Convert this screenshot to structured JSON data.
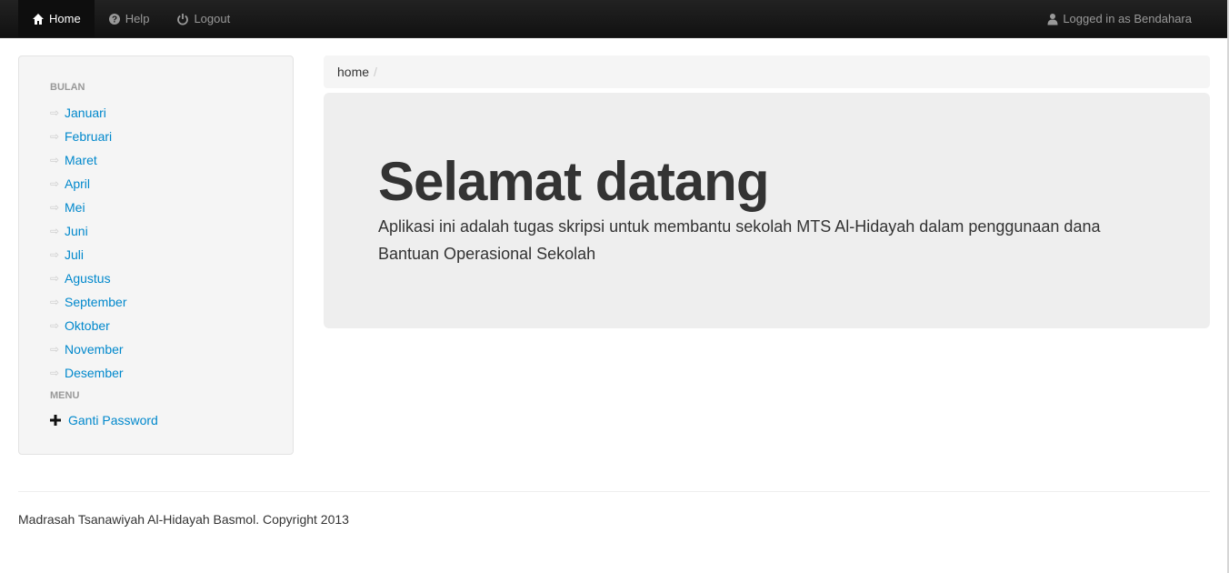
{
  "navbar": {
    "home_label": "Home",
    "help_label": "Help",
    "logout_label": "Logout",
    "user_label": "Logged in as Bendahara"
  },
  "sidebar": {
    "bulan_header": "BULAN",
    "months": [
      "Januari",
      "Februari",
      "Maret",
      "April",
      "Mei",
      "Juni",
      "Juli",
      "Agustus",
      "September",
      "Oktober",
      "November",
      "Desember"
    ],
    "menu_header": "MENU",
    "menu_items": [
      "Ganti Password"
    ]
  },
  "breadcrumb": {
    "current": "home",
    "divider": "/"
  },
  "hero": {
    "title": "Selamat datang",
    "description": "Aplikasi ini adalah tugas skripsi untuk membantu sekolah MTS Al-Hidayah dalam penggunaan dana Bantuan Operasional Sekolah"
  },
  "footer": {
    "text": "Madrasah Tsanawiyah Al-Hidayah Basmol. Copyright 2013"
  },
  "icons": {
    "home": "home-icon",
    "help": "question-circle-icon",
    "logout": "power-icon",
    "user": "user-icon",
    "month_bullet": "arrow-right-icon",
    "plus": "plus-icon"
  },
  "colors": {
    "navbar_bg": "#1b1b1b",
    "link": "#0088cc",
    "well_bg": "#f5f5f5",
    "hero_bg": "#eeeeee"
  }
}
